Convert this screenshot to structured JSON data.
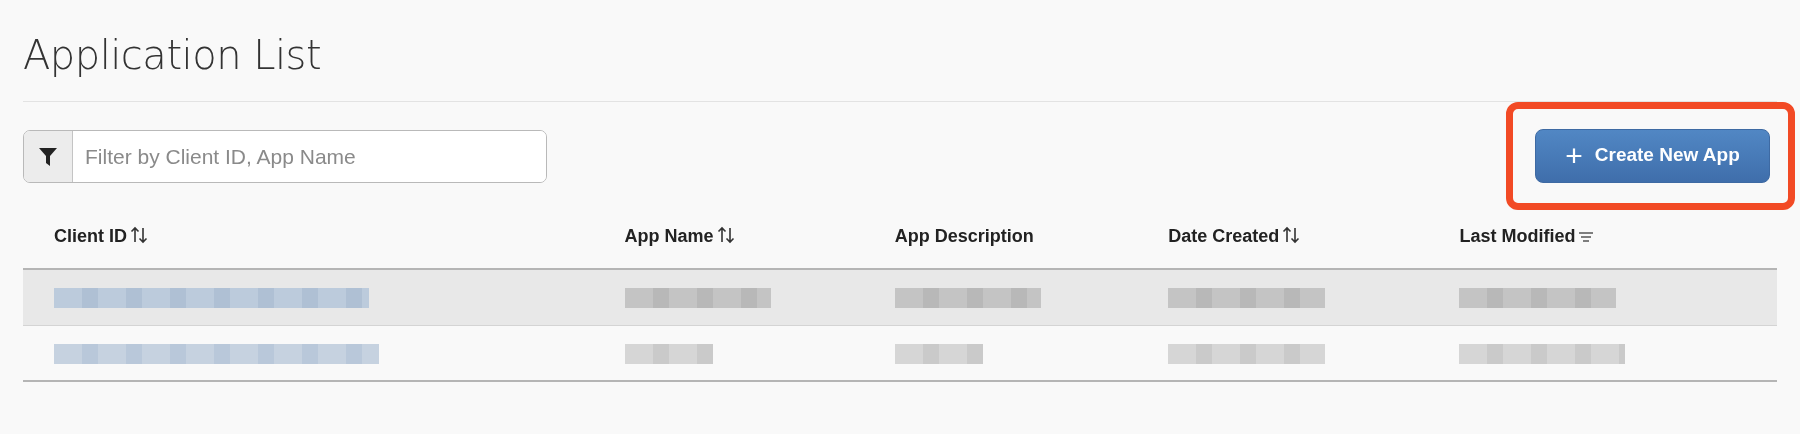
{
  "page": {
    "title": "Application List"
  },
  "filter": {
    "placeholder": "Filter by Client ID, App Name"
  },
  "create_button": {
    "label": "Create New App",
    "icon": "+",
    "highlighted": true
  },
  "table": {
    "columns": [
      {
        "label": "Client ID",
        "sortable": true,
        "sorted": false
      },
      {
        "label": "App Name",
        "sortable": true,
        "sorted": false
      },
      {
        "label": "App Description",
        "sortable": false,
        "sorted": false
      },
      {
        "label": "Date Created",
        "sortable": true,
        "sorted": false
      },
      {
        "label": "Last Modified",
        "sorted": true
      }
    ],
    "rows": [
      {
        "highlighted": true,
        "cells": [
          {
            "kind": "redacted",
            "link": true
          },
          {
            "kind": "redacted"
          },
          {
            "kind": "redacted"
          },
          {
            "kind": "redacted"
          },
          {
            "kind": "redacted"
          }
        ]
      },
      {
        "highlighted": false,
        "cells": [
          {
            "kind": "redacted",
            "link": true
          },
          {
            "kind": "redacted"
          },
          {
            "kind": "redacted"
          },
          {
            "kind": "redacted"
          },
          {
            "kind": "redacted"
          }
        ]
      }
    ]
  }
}
